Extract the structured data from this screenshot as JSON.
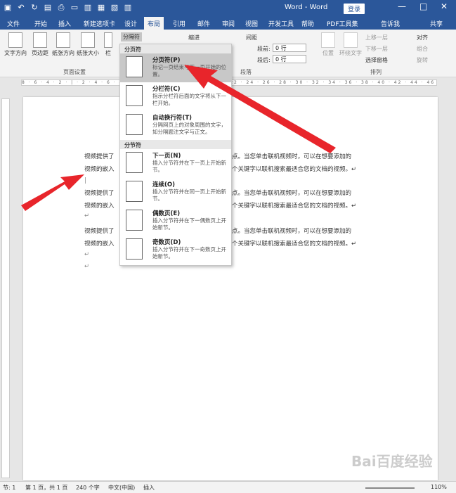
{
  "title": {
    "app": "Word - Word",
    "login": "登录"
  },
  "tabs": [
    "文件",
    "开始",
    "插入",
    "新建选项卡",
    "设计",
    "布局",
    "引用",
    "邮件",
    "审阅",
    "视图",
    "开发工具",
    "帮助",
    "PDF工具集",
    "告诉我",
    "共享"
  ],
  "ribbon": {
    "buttons": [
      "文字方向",
      "页边距",
      "纸张方向",
      "纸张大小",
      "栏"
    ],
    "breaks_label": "分隔符",
    "indent_label": "缩进",
    "spacing_label": "间距",
    "before_label": "段前:",
    "after_label": "段后:",
    "before_val": "0 行",
    "after_val": "0 行",
    "group_page": "页面设置",
    "group_para": "段落",
    "group_arrange": "排列",
    "arrange": [
      "位置",
      "环绕文字",
      "上移一层",
      "下移一层",
      "选择窗格",
      "对齐",
      "组合",
      "旋转"
    ]
  },
  "menu": {
    "header1": "分页符",
    "header2": "分节符",
    "items": [
      {
        "title": "分页符(P)",
        "desc": "标记一页结束与下一页开始的位置。"
      },
      {
        "title": "分栏符(C)",
        "desc": "指示分栏符后面的文字将从下一栏开始。"
      },
      {
        "title": "自动换行符(T)",
        "desc": "分隔网页上的对象周围的文字，如分隔题注文字与正文。"
      },
      {
        "title": "下一页(N)",
        "desc": "插入分节符并在下一页上开始新节。"
      },
      {
        "title": "连续(O)",
        "desc": "插入分节符并在同一页上开始新节。"
      },
      {
        "title": "偶数页(E)",
        "desc": "插入分节符并在下一偶数页上开始新节。"
      },
      {
        "title": "奇数页(D)",
        "desc": "插入分节符并在下一奇数页上开始新节。"
      }
    ]
  },
  "doc": {
    "line1a": "视频提供了",
    "line1b": "点。当您单击联机视频时，可以在想要添加的",
    "line2a": "视频的嵌入",
    "line2b": "个关键字以联机搜索最适合您的文档的视频。↵"
  },
  "status": {
    "page": "节: 1",
    "pages": "第 1 页，共 1 页",
    "words": "240 个字",
    "lang": "中文(中国)",
    "mode": "插入",
    "zoom": "110%"
  },
  "watermark": "Bai百度经验"
}
